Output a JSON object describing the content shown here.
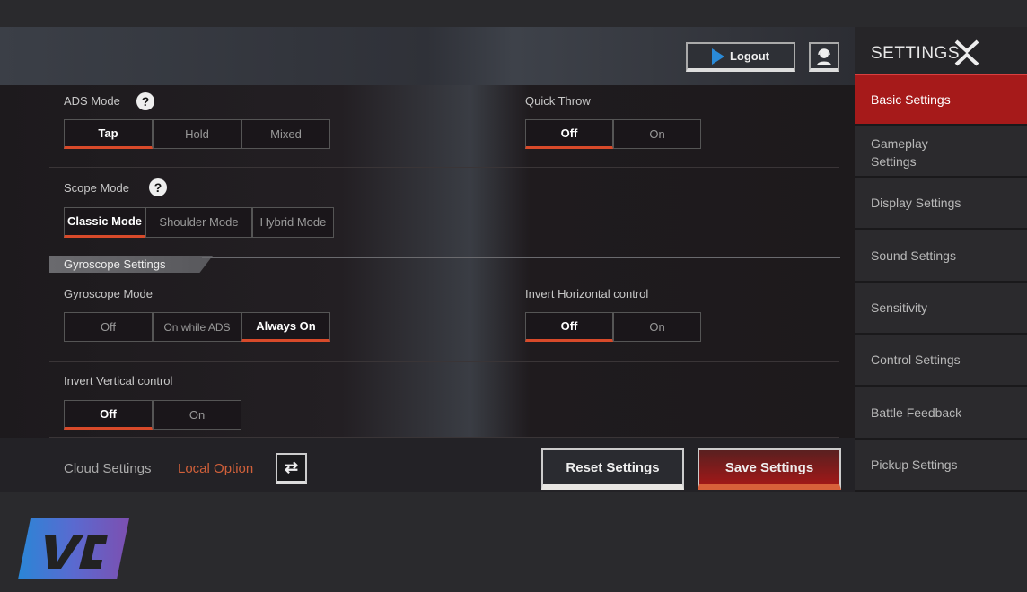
{
  "header": {
    "logout_label": "Logout"
  },
  "sidebar": {
    "title": "SETTINGS",
    "items": [
      {
        "label": "Basic Settings",
        "active": true
      },
      {
        "label": "Gameplay Settings"
      },
      {
        "label": "Display Settings"
      },
      {
        "label": "Sound Settings"
      },
      {
        "label": "Sensitivity"
      },
      {
        "label": "Control Settings"
      },
      {
        "label": "Battle Feedback"
      },
      {
        "label": "Pickup Settings"
      }
    ]
  },
  "settings": {
    "ads_mode": {
      "label": "ADS Mode",
      "options": [
        "Tap",
        "Hold",
        "Mixed"
      ],
      "selected": "Tap"
    },
    "quick_throw": {
      "label": "Quick Throw",
      "options": [
        "Off",
        "On"
      ],
      "selected": "Off"
    },
    "scope_mode": {
      "label": "Scope Mode",
      "options": [
        "Classic Mode",
        "Shoulder Mode",
        "Hybrid Mode"
      ],
      "selected": "Classic Mode"
    },
    "gyro_section": "Gyroscope Settings",
    "gyro_mode": {
      "label": "Gyroscope Mode",
      "options": [
        "Off",
        "On while ADS",
        "Always On"
      ],
      "selected": "Always On"
    },
    "invert_h": {
      "label": "Invert Horizontal control",
      "options": [
        "Off",
        "On"
      ],
      "selected": "Off"
    },
    "invert_v": {
      "label": "Invert Vertical control",
      "options": [
        "Off",
        "On"
      ],
      "selected": "Off"
    }
  },
  "footer": {
    "cloud": "Cloud Settings",
    "local": "Local Option",
    "reset": "Reset Settings",
    "save": "Save Settings"
  },
  "help_glyph": "?",
  "logo_text": "VC",
  "colors": {
    "accent": "#a61a1a",
    "underline": "#d84a2a",
    "local": "#d0603a"
  }
}
